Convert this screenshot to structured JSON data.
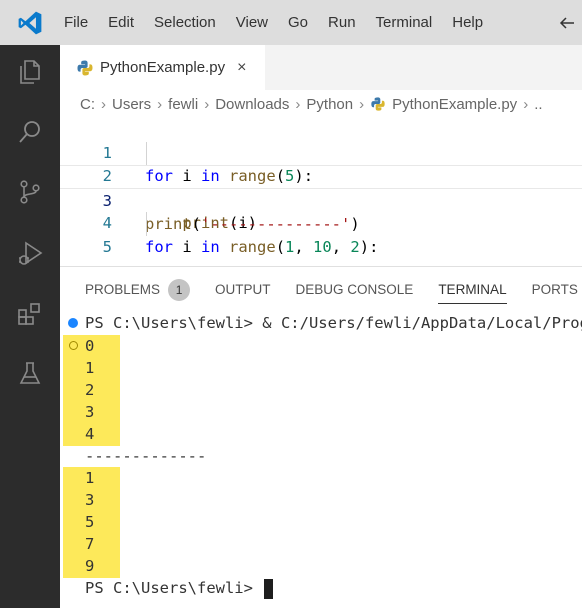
{
  "menu": {
    "items": [
      "File",
      "Edit",
      "Selection",
      "View",
      "Go",
      "Run",
      "Terminal",
      "Help"
    ]
  },
  "activity_bar": {
    "icons": [
      "explorer-icon",
      "search-icon",
      "source-control-icon",
      "run-debug-icon",
      "extensions-icon",
      "testing-icon"
    ]
  },
  "editor": {
    "tab": {
      "label": "PythonExample.py",
      "close": "×"
    },
    "breadcrumb": [
      "C:",
      "Users",
      "fewli",
      "Downloads",
      "Python",
      "PythonExample.py",
      ".."
    ],
    "line_numbers": [
      "1",
      "2",
      "3",
      "4",
      "5"
    ]
  },
  "panel": {
    "tabs": {
      "problems": "PROBLEMS",
      "problems_count": "1",
      "output": "OUTPUT",
      "debug_console": "DEBUG CONSOLE",
      "terminal": "TERMINAL",
      "ports": "PORTS"
    },
    "terminal": {
      "prompt_cmd": "PS C:\\Users\\fewli> & C:/Users/fewli/AppData/Local/Progra",
      "output_first": [
        "0",
        "1",
        "2",
        "3",
        "4"
      ],
      "separator": "-------------",
      "output_second": [
        "1",
        "3",
        "5",
        "7",
        "9"
      ],
      "prompt_final": "PS C:\\Users\\fewli> "
    }
  },
  "colors": {
    "highlight": "#fde95a",
    "activity_bar": "#2c2c2c",
    "keyword": "#0000ff",
    "function": "#795e26",
    "number": "#098658",
    "string": "#a31515",
    "status_dot": "#1a85ff"
  }
}
